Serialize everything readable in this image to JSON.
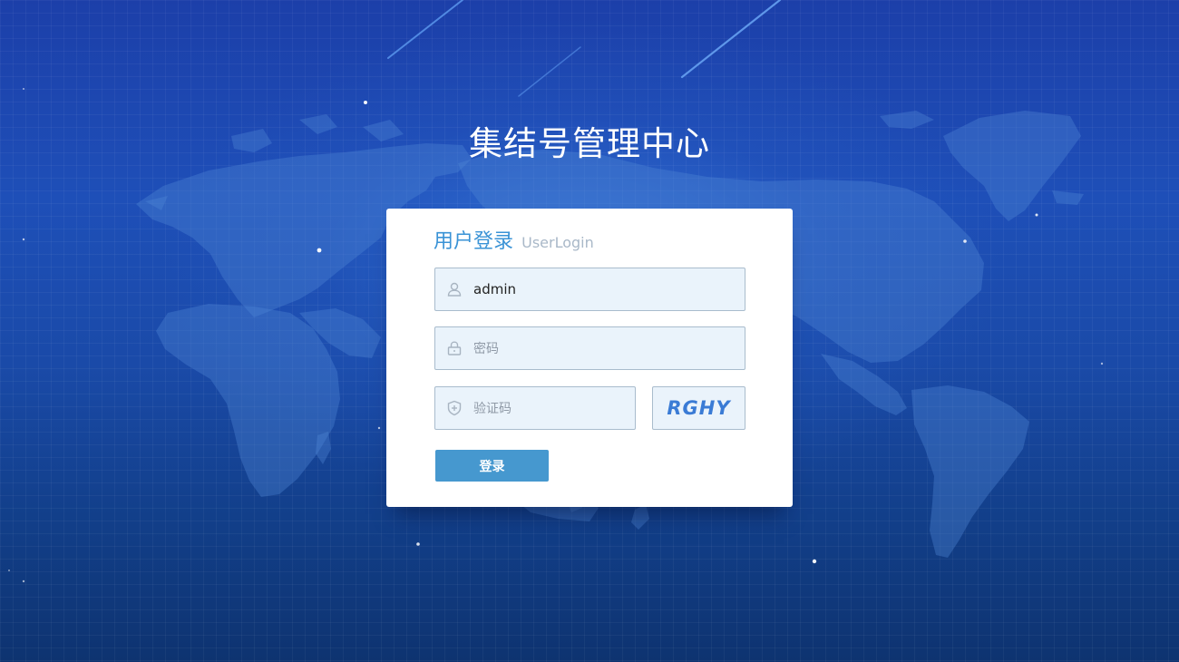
{
  "app": {
    "title": "集结号管理中心"
  },
  "login": {
    "title": "用户登录",
    "subtitle": "UserLogin",
    "username": {
      "value": "admin",
      "icon": "user-icon"
    },
    "password": {
      "value": "",
      "placeholder": "密码",
      "icon": "lock-icon"
    },
    "captcha": {
      "value": "",
      "placeholder": "验证码",
      "icon": "shield-plus-icon",
      "image_text": "RGHY"
    },
    "submit_label": "登录"
  },
  "colors": {
    "accent": "#3a93d6",
    "button": "#4698cf",
    "field_bg": "#eaf3fb",
    "background_top": "#1c3fa9",
    "background_bottom": "#0e3370"
  }
}
